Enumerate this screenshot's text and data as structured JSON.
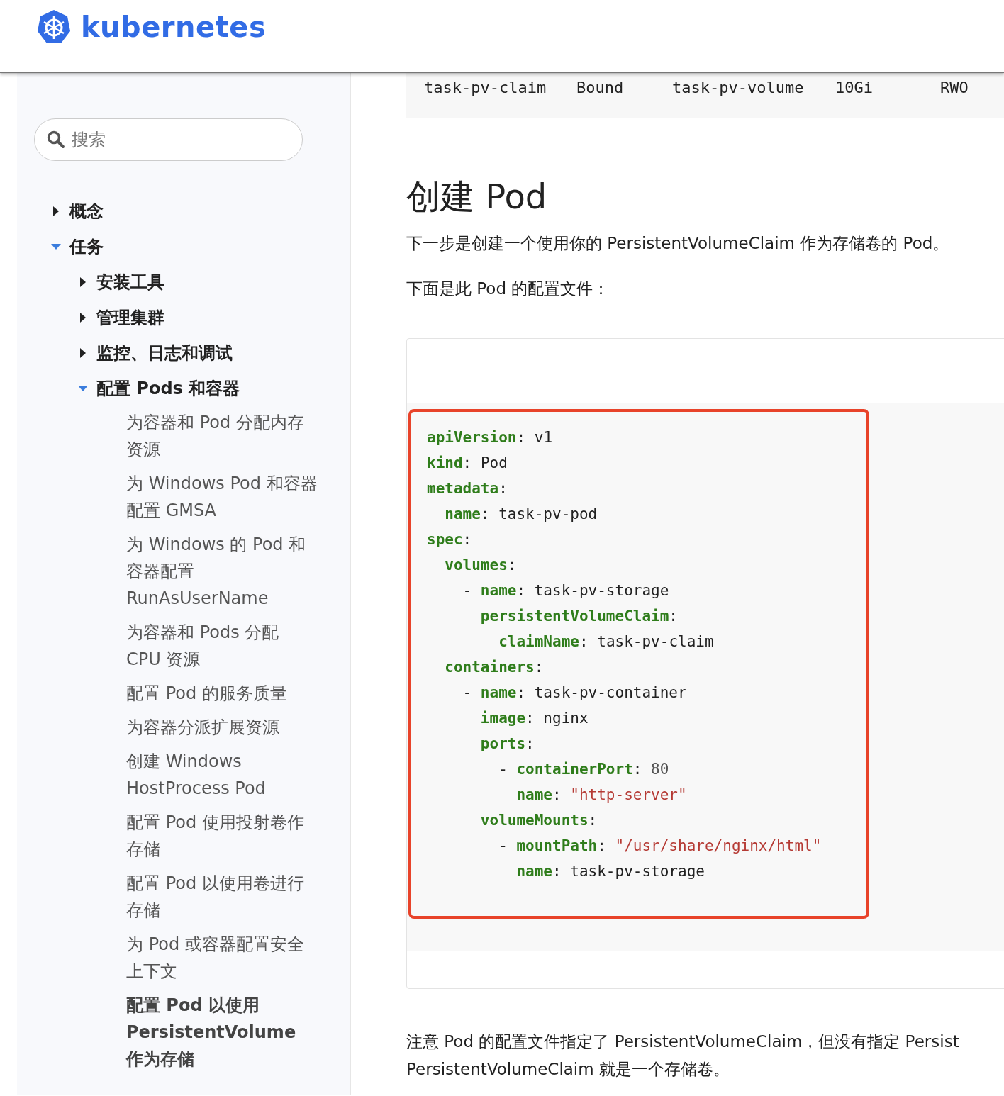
{
  "header": {
    "logo_text": "kubernetes"
  },
  "sidebar": {
    "search": {
      "placeholder": "搜索"
    },
    "items": [
      {
        "label": "概念",
        "expanded": false
      },
      {
        "label": "任务",
        "expanded": true,
        "children": [
          {
            "label": "安装工具",
            "expanded": false
          },
          {
            "label": "管理集群",
            "expanded": false
          },
          {
            "label": "监控、日志和调试",
            "expanded": false
          },
          {
            "label": "配置 Pods 和容器",
            "expanded": true,
            "children": [
              {
                "label": "为容器和 Pod 分配内存资源",
                "selected": false
              },
              {
                "label": "为 Windows Pod 和容器配置 GMSA",
                "selected": false
              },
              {
                "label": "为 Windows 的 Pod 和容器配置 RunAsUserName",
                "selected": false
              },
              {
                "label": "为容器和 Pods 分配 CPU 资源",
                "selected": false
              },
              {
                "label": "配置 Pod 的服务质量",
                "selected": false
              },
              {
                "label": "为容器分派扩展资源",
                "selected": false
              },
              {
                "label": "创建 Windows HostProcess Pod",
                "selected": false
              },
              {
                "label": "配置 Pod 使用投射卷作存储",
                "selected": false
              },
              {
                "label": "配置 Pod 以使用卷进行存储",
                "selected": false
              },
              {
                "label": "为 Pod 或容器配置安全上下文",
                "selected": false
              },
              {
                "label": "配置 Pod 以使用 PersistentVolume 作为存储",
                "selected": true
              }
            ]
          }
        ]
      }
    ]
  },
  "content": {
    "output_row": [
      "task-pv-claim",
      "Bound",
      "task-pv-volume",
      "10Gi",
      "RWO"
    ],
    "heading": "创建 Pod",
    "paragraphs": [
      "下一步是创建一个使用你的 PersistentVolumeClaim 作为存储卷的 Pod。",
      "下面是此 Pod 的配置文件："
    ],
    "code": {
      "highlighted": true,
      "lines": [
        {
          "key": "apiVersion",
          "punct": ":",
          "value": "v1",
          "kind": "plain"
        },
        {
          "key": "kind",
          "punct": ":",
          "value": "Pod",
          "kind": "plain"
        },
        {
          "key": "metadata",
          "punct": ":",
          "children": [
            {
              "key": "name",
              "punct": ":",
              "value": "task-pv-pod",
              "kind": "plain"
            }
          ]
        },
        {
          "key": "spec",
          "punct": ":",
          "children": [
            {
              "key": "volumes",
              "punct": ":",
              "children": [
                {
                  "dash": "-",
                  "entries": [
                    {
                      "key": "name",
                      "punct": ":",
                      "value": "task-pv-storage",
                      "kind": "plain"
                    },
                    {
                      "key": "persistentVolumeClaim",
                      "punct": ":",
                      "children": [
                        {
                          "key": "claimName",
                          "punct": ":",
                          "value": "task-pv-claim",
                          "kind": "plain"
                        }
                      ]
                    }
                  ]
                }
              ]
            },
            {
              "key": "containers",
              "punct": ":",
              "children": [
                {
                  "dash": "-",
                  "entries": [
                    {
                      "key": "name",
                      "punct": ":",
                      "value": "task-pv-container",
                      "kind": "plain"
                    },
                    {
                      "key": "image",
                      "punct": ":",
                      "value": "nginx",
                      "kind": "plain"
                    },
                    {
                      "key": "ports",
                      "punct": ":",
                      "children": [
                        {
                          "dash": "-",
                          "entries": [
                            {
                              "key": "containerPort",
                              "punct": ":",
                              "value": "80",
                              "kind": "number"
                            },
                            {
                              "key": "name",
                              "punct": ":",
                              "value": "\"http-server\"",
                              "kind": "string"
                            }
                          ]
                        }
                      ]
                    },
                    {
                      "key": "volumeMounts",
                      "punct": ":",
                      "children": [
                        {
                          "dash": "-",
                          "entries": [
                            {
                              "key": "mountPath",
                              "punct": ":",
                              "value": "\"/usr/share/nginx/html\"",
                              "kind": "string"
                            },
                            {
                              "key": "name",
                              "punct": ":",
                              "value": "task-pv-storage",
                              "kind": "plain"
                            }
                          ]
                        }
                      ]
                    }
                  ]
                }
              ]
            }
          ]
        }
      ]
    },
    "note_lines": [
      "注意 Pod 的配置文件指定了 PersistentVolumeClaim，但没有指定 Persist",
      "PersistentVolumeClaim 就是一个存储卷。"
    ]
  }
}
